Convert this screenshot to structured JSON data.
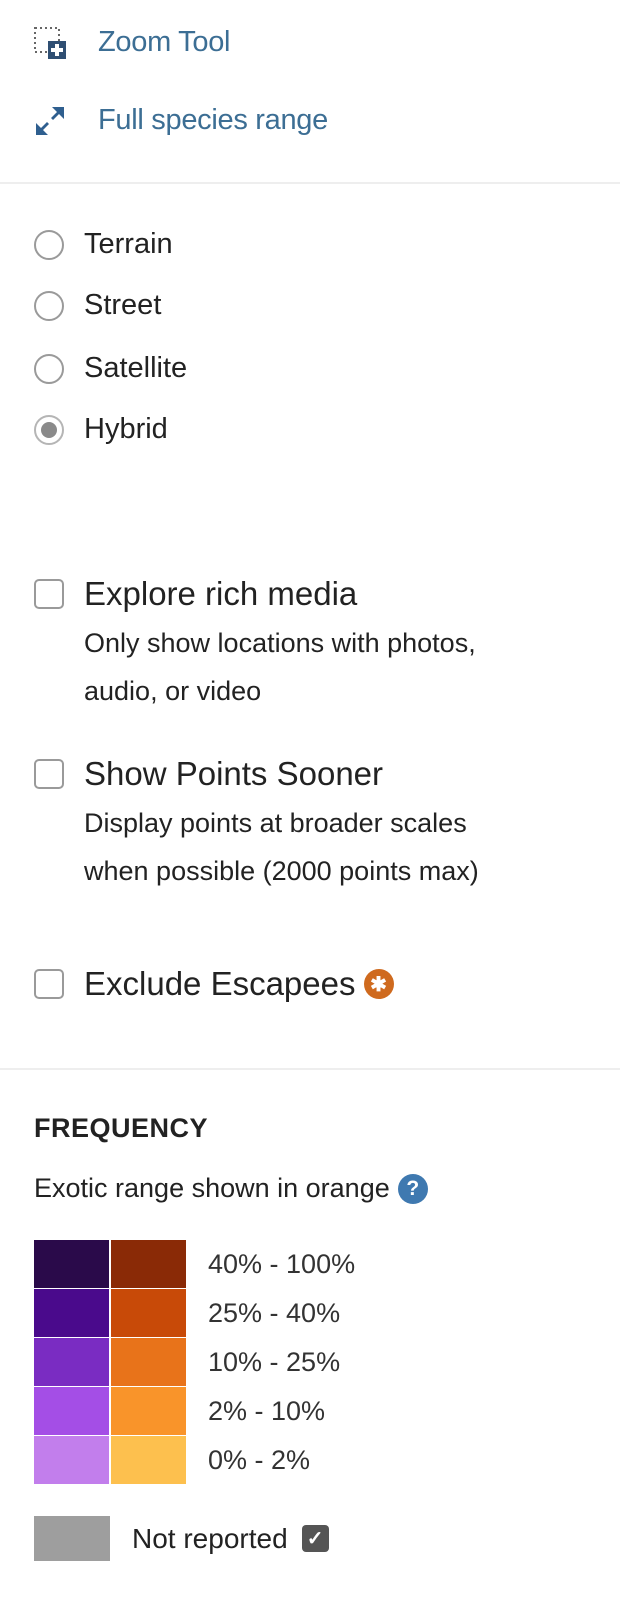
{
  "tools": [
    {
      "label": "Zoom Tool",
      "icon": "zoom-tool-icon"
    },
    {
      "label": "Full species range",
      "icon": "expand-arrows-icon"
    }
  ],
  "map_types": [
    {
      "label": "Terrain",
      "checked": false
    },
    {
      "label": "Street",
      "checked": false
    },
    {
      "label": "Satellite",
      "checked": false
    },
    {
      "label": "Hybrid",
      "checked": true
    }
  ],
  "filters": [
    {
      "label": "Explore rich media",
      "desc": "Only show locations with photos, audio, or video",
      "checked": false
    },
    {
      "label": "Show Points Sooner",
      "desc": "Display points at broader scales when possible (2000 points max)",
      "checked": false
    },
    {
      "label": "Exclude Escapees",
      "desc": "",
      "checked": false,
      "badge_icon": "escapee-info-icon"
    }
  ],
  "frequency": {
    "title": "FREQUENCY",
    "subtitle": "Exotic range shown in orange",
    "help_icon": "help-question-icon",
    "legend": [
      {
        "label": "40% - 100%",
        "native_color": "#2a0a4a",
        "exotic_color": "#8a2a06"
      },
      {
        "label": "25% - 40%",
        "native_color": "#4a0a8c",
        "exotic_color": "#c84a08"
      },
      {
        "label": "10% - 25%",
        "native_color": "#7a2cc2",
        "exotic_color": "#e8731a"
      },
      {
        "label": "2% - 10%",
        "native_color": "#a44ee6",
        "exotic_color": "#f9942a"
      },
      {
        "label": "0% - 2%",
        "native_color": "#c27eec",
        "exotic_color": "#fdc04e"
      }
    ],
    "not_reported": {
      "label": "Not reported",
      "color": "#9e9e9e",
      "checked": true
    }
  }
}
